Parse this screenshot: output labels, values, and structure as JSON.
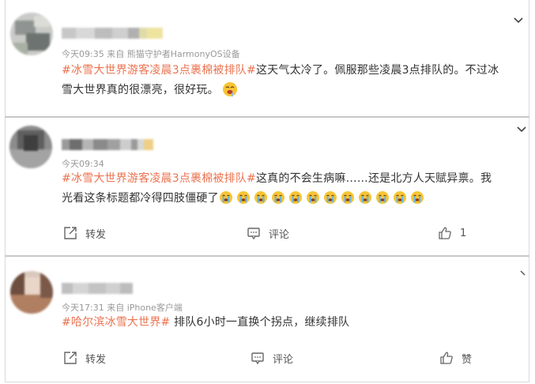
{
  "posts": [
    {
      "meta": "今天09:35  来自 熊猫守护者HarmonyOS设备",
      "tag": "#冰雪大世界游客凌晨3点裹棉被排队#",
      "text_line1": "这天气太冷了。佩服那些凌晨3点排队的。不过冰",
      "text_line2": "雪大世界真的很漂亮，很好玩。",
      "emoji_icon": "drooling-face-icon"
    },
    {
      "meta": "今天09:34",
      "tag": "#冰雪大世界游客凌晨3点裹棉被排队#",
      "text_line1": "这真的不会生病嘛……还是北方人天赋异禀。我",
      "text_line2": "光看这条标题都冷得四肢僵硬了",
      "emoji_icon": "crying-face-icon",
      "emoji_count": 12,
      "repost_label": "转发",
      "comment_label": "评论",
      "like_count": "1"
    },
    {
      "meta": "今天17:31  来自 iPhone客户端",
      "tag": "#哈尔滨冰雪大世界#",
      "text": " 排队6小时一直换个拐点，继续排队",
      "repost_label": "转发",
      "comment_label": "评论",
      "like_label": "赞"
    }
  ],
  "colors": {
    "tag": "#eb7350",
    "meta": "#999999",
    "text": "#333333"
  }
}
